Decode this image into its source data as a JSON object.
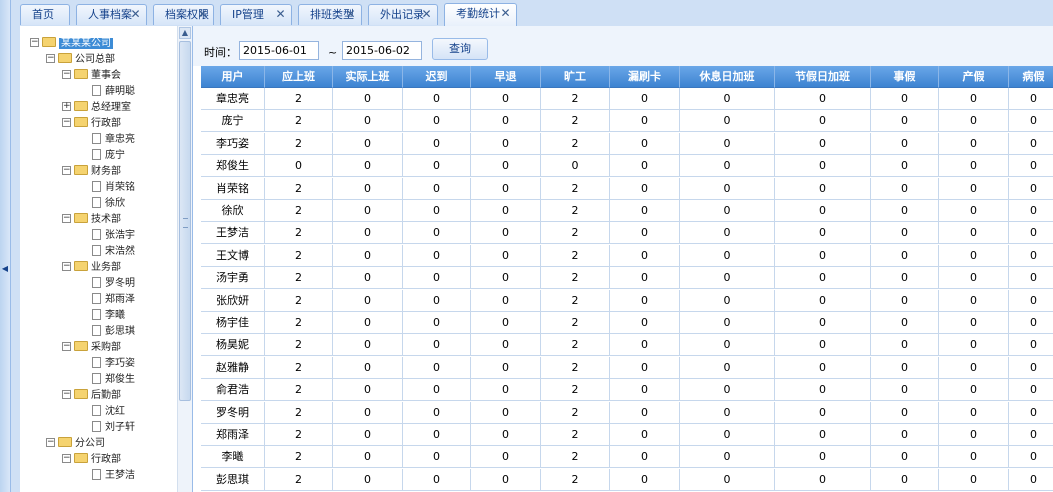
{
  "tabs": [
    {
      "label": "首页",
      "closable": false,
      "active": false
    },
    {
      "label": "人事档案",
      "closable": true,
      "active": false
    },
    {
      "label": "档案权限",
      "closable": true,
      "active": false
    },
    {
      "label": "IP管理",
      "closable": true,
      "active": false
    },
    {
      "label": "排班类型",
      "closable": true,
      "active": false
    },
    {
      "label": "外出记录",
      "closable": true,
      "active": false
    },
    {
      "label": "考勤统计",
      "closable": true,
      "active": true
    }
  ],
  "tree": [
    {
      "label": "某某某公司",
      "type": "folder",
      "level": 0,
      "toggle": "minus",
      "selected": true
    },
    {
      "label": "公司总部",
      "type": "folder",
      "level": 1,
      "toggle": "minus"
    },
    {
      "label": "董事会",
      "type": "folder",
      "level": 2,
      "toggle": "minus"
    },
    {
      "label": "薛明聪",
      "type": "doc",
      "level": 3
    },
    {
      "label": "总经理室",
      "type": "folder",
      "level": 2,
      "toggle": "plus"
    },
    {
      "label": "行政部",
      "type": "folder",
      "level": 2,
      "toggle": "minus"
    },
    {
      "label": "章忠亮",
      "type": "doc",
      "level": 3
    },
    {
      "label": "庞宁",
      "type": "doc",
      "level": 3
    },
    {
      "label": "财务部",
      "type": "folder",
      "level": 2,
      "toggle": "minus"
    },
    {
      "label": "肖荣铭",
      "type": "doc",
      "level": 3
    },
    {
      "label": "徐欣",
      "type": "doc",
      "level": 3
    },
    {
      "label": "技术部",
      "type": "folder",
      "level": 2,
      "toggle": "minus"
    },
    {
      "label": "张浩宇",
      "type": "doc",
      "level": 3
    },
    {
      "label": "宋浩然",
      "type": "doc",
      "level": 3
    },
    {
      "label": "业务部",
      "type": "folder",
      "level": 2,
      "toggle": "minus"
    },
    {
      "label": "罗冬明",
      "type": "doc",
      "level": 3
    },
    {
      "label": "郑雨泽",
      "type": "doc",
      "level": 3
    },
    {
      "label": "李曦",
      "type": "doc",
      "level": 3
    },
    {
      "label": "彭思琪",
      "type": "doc",
      "level": 3
    },
    {
      "label": "采购部",
      "type": "folder",
      "level": 2,
      "toggle": "minus"
    },
    {
      "label": "李巧姿",
      "type": "doc",
      "level": 3
    },
    {
      "label": "郑俊生",
      "type": "doc",
      "level": 3
    },
    {
      "label": "后勤部",
      "type": "folder",
      "level": 2,
      "toggle": "minus"
    },
    {
      "label": "沈红",
      "type": "doc",
      "level": 3
    },
    {
      "label": "刘子轩",
      "type": "doc",
      "level": 3
    },
    {
      "label": "分公司",
      "type": "folder",
      "level": 1,
      "toggle": "minus"
    },
    {
      "label": "行政部",
      "type": "folder",
      "level": 2,
      "toggle": "minus"
    },
    {
      "label": "王梦洁",
      "type": "doc",
      "level": 3
    }
  ],
  "toolbar": {
    "time_label": "时间：",
    "start_date": "2015-06-01",
    "separator": "~",
    "end_date": "2015-06-02",
    "query_label": "查询"
  },
  "grid": {
    "columns": [
      "用户",
      "应上班",
      "实际上班",
      "迟到",
      "早退",
      "旷工",
      "漏刷卡",
      "休息日加班",
      "节假日加班",
      "事假",
      "产假",
      "病假"
    ],
    "rows": [
      [
        "章忠亮",
        "2",
        "0",
        "0",
        "0",
        "2",
        "0",
        "0",
        "0",
        "0",
        "0",
        "0"
      ],
      [
        "庞宁",
        "2",
        "0",
        "0",
        "0",
        "2",
        "0",
        "0",
        "0",
        "0",
        "0",
        "0"
      ],
      [
        "李巧姿",
        "2",
        "0",
        "0",
        "0",
        "2",
        "0",
        "0",
        "0",
        "0",
        "0",
        "0"
      ],
      [
        "郑俊生",
        "0",
        "0",
        "0",
        "0",
        "0",
        "0",
        "0",
        "0",
        "0",
        "0",
        "0"
      ],
      [
        "肖荣铭",
        "2",
        "0",
        "0",
        "0",
        "2",
        "0",
        "0",
        "0",
        "0",
        "0",
        "0"
      ],
      [
        "徐欣",
        "2",
        "0",
        "0",
        "0",
        "2",
        "0",
        "0",
        "0",
        "0",
        "0",
        "0"
      ],
      [
        "王梦洁",
        "2",
        "0",
        "0",
        "0",
        "2",
        "0",
        "0",
        "0",
        "0",
        "0",
        "0"
      ],
      [
        "王文博",
        "2",
        "0",
        "0",
        "0",
        "2",
        "0",
        "0",
        "0",
        "0",
        "0",
        "0"
      ],
      [
        "汤宇勇",
        "2",
        "0",
        "0",
        "0",
        "2",
        "0",
        "0",
        "0",
        "0",
        "0",
        "0"
      ],
      [
        "张欣妍",
        "2",
        "0",
        "0",
        "0",
        "2",
        "0",
        "0",
        "0",
        "0",
        "0",
        "0"
      ],
      [
        "杨宇佳",
        "2",
        "0",
        "0",
        "0",
        "2",
        "0",
        "0",
        "0",
        "0",
        "0",
        "0"
      ],
      [
        "杨昊妮",
        "2",
        "0",
        "0",
        "0",
        "2",
        "0",
        "0",
        "0",
        "0",
        "0",
        "0"
      ],
      [
        "赵雅静",
        "2",
        "0",
        "0",
        "0",
        "2",
        "0",
        "0",
        "0",
        "0",
        "0",
        "0"
      ],
      [
        "俞君浩",
        "2",
        "0",
        "0",
        "0",
        "2",
        "0",
        "0",
        "0",
        "0",
        "0",
        "0"
      ],
      [
        "罗冬明",
        "2",
        "0",
        "0",
        "0",
        "2",
        "0",
        "0",
        "0",
        "0",
        "0",
        "0"
      ],
      [
        "郑雨泽",
        "2",
        "0",
        "0",
        "0",
        "2",
        "0",
        "0",
        "0",
        "0",
        "0",
        "0"
      ],
      [
        "李曦",
        "2",
        "0",
        "0",
        "0",
        "2",
        "0",
        "0",
        "0",
        "0",
        "0",
        "0"
      ],
      [
        "彭思琪",
        "2",
        "0",
        "0",
        "0",
        "2",
        "0",
        "0",
        "0",
        "0",
        "0",
        "0"
      ]
    ]
  },
  "icons": {
    "close": "close-icon",
    "folder": "folder-icon",
    "doc": "document-icon",
    "expand": "plus-icon",
    "collapse": "minus-icon"
  },
  "colors": {
    "header_start": "#6aa7e8",
    "header_end": "#3d83d1",
    "tab_text": "#15428b",
    "selected_node": "#3d8cd6"
  }
}
